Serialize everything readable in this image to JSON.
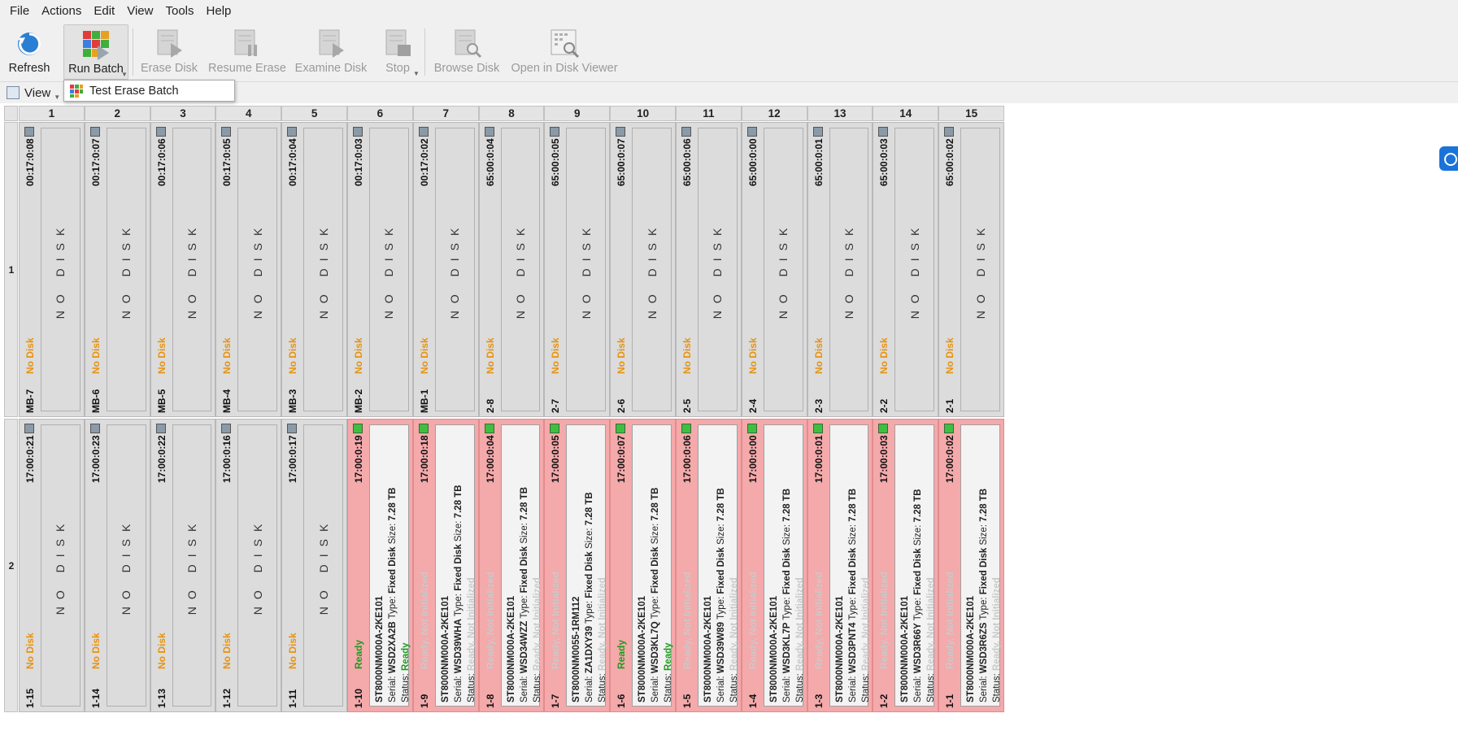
{
  "menu": [
    "File",
    "Actions",
    "Edit",
    "View",
    "Tools",
    "Help"
  ],
  "toolbar": {
    "refresh": "Refresh",
    "run_batch": "Run Batch",
    "erase_disk": "Erase Disk",
    "resume_erase": "Resume Erase",
    "examine_disk": "Examine Disk",
    "stop": "Stop",
    "browse_disk": "Browse Disk",
    "open_viewer": "Open in Disk Viewer"
  },
  "viewbar": {
    "view_label": "View"
  },
  "popup": {
    "item": "Test Erase Batch"
  },
  "grid": {
    "columns": [
      "1",
      "2",
      "3",
      "4",
      "5",
      "6",
      "7",
      "8",
      "9",
      "10",
      "11",
      "12",
      "13",
      "14",
      "15"
    ],
    "rows": [
      "1",
      "2"
    ],
    "no_disk_text": "NO DISK",
    "row1": [
      {
        "id": "MB-7",
        "time": "00:17:0:08",
        "status": "No Disk"
      },
      {
        "id": "MB-6",
        "time": "00:17:0:07",
        "status": "No Disk"
      },
      {
        "id": "MB-5",
        "time": "00:17:0:06",
        "status": "No Disk"
      },
      {
        "id": "MB-4",
        "time": "00:17:0:05",
        "status": "No Disk"
      },
      {
        "id": "MB-3",
        "time": "00:17:0:04",
        "status": "No Disk"
      },
      {
        "id": "MB-2",
        "time": "00:17:0:03",
        "status": "No Disk"
      },
      {
        "id": "MB-1",
        "time": "00:17:0:02",
        "status": "No Disk"
      },
      {
        "id": "2-8",
        "time": "65:00:0:04",
        "status": "No Disk"
      },
      {
        "id": "2-7",
        "time": "65:00:0:05",
        "status": "No Disk"
      },
      {
        "id": "2-6",
        "time": "65:00:0:07",
        "status": "No Disk"
      },
      {
        "id": "2-5",
        "time": "65:00:0:06",
        "status": "No Disk"
      },
      {
        "id": "2-4",
        "time": "65:00:0:00",
        "status": "No Disk"
      },
      {
        "id": "2-3",
        "time": "65:00:0:01",
        "status": "No Disk"
      },
      {
        "id": "2-2",
        "time": "65:00:0:03",
        "status": "No Disk"
      },
      {
        "id": "2-1",
        "time": "65:00:0:02",
        "status": "No Disk"
      }
    ],
    "row2": [
      {
        "id": "1-15",
        "time": "17:00:0:21",
        "status": "No Disk",
        "disk": false
      },
      {
        "id": "1-14",
        "time": "17:00:0:23",
        "status": "No Disk",
        "disk": false
      },
      {
        "id": "1-13",
        "time": "17:00:0:22",
        "status": "No Disk",
        "disk": false
      },
      {
        "id": "1-12",
        "time": "17:00:0:16",
        "status": "No Disk",
        "disk": false
      },
      {
        "id": "1-11",
        "time": "17:00:0:17",
        "status": "No Disk",
        "disk": false
      },
      {
        "id": "1-10",
        "time": "17:00:0:19",
        "status": "Ready",
        "disk": true,
        "model": "ST8000NM000A-2KE101",
        "serial": "WSD2XA2B",
        "type": "Fixed Disk",
        "size": "7.28 TB",
        "disk_status": "Ready"
      },
      {
        "id": "1-9",
        "time": "17:00:0:18",
        "status": "Ready, Not Initialized",
        "disk": true,
        "model": "ST8000NM000A-2KE101",
        "serial": "WSD39WHA",
        "type": "Fixed Disk",
        "size": "7.28 TB",
        "disk_status": "Ready, Not Initialized"
      },
      {
        "id": "1-8",
        "time": "17:00:0:04",
        "status": "Ready, Not Initialized",
        "disk": true,
        "model": "ST8000NM000A-2KE101",
        "serial": "WSD34WZZ",
        "type": "Fixed Disk",
        "size": "7.28 TB",
        "disk_status": "Ready, Not Initialized"
      },
      {
        "id": "1-7",
        "time": "17:00:0:05",
        "status": "Ready, Not Initialized",
        "disk": true,
        "model": "ST8000NM0055-1RM112",
        "serial": "ZA1DXY39",
        "type": "Fixed Disk",
        "size": "7.28 TB",
        "disk_status": "Ready, Not Initialized"
      },
      {
        "id": "1-6",
        "time": "17:00:0:07",
        "status": "Ready",
        "disk": true,
        "model": "ST8000NM000A-2KE101",
        "serial": "WSD3KL7Q",
        "type": "Fixed Disk",
        "size": "7.28 TB",
        "disk_status": "Ready"
      },
      {
        "id": "1-5",
        "time": "17:00:0:06",
        "status": "Ready, Not Initialized",
        "disk": true,
        "model": "ST8000NM000A-2KE101",
        "serial": "WSD39W89",
        "type": "Fixed Disk",
        "size": "7.28 TB",
        "disk_status": "Ready, Not Initialized"
      },
      {
        "id": "1-4",
        "time": "17:00:0:00",
        "status": "Ready, Not Initialized",
        "disk": true,
        "model": "ST8000NM000A-2KE101",
        "serial": "WSD3KL7P",
        "type": "Fixed Disk",
        "size": "7.28 TB",
        "disk_status": "Ready, Not Initialized"
      },
      {
        "id": "1-3",
        "time": "17:00:0:01",
        "status": "Ready, Not Initialized",
        "disk": true,
        "model": "ST8000NM000A-2KE101",
        "serial": "WSD3PNT4",
        "type": "Fixed Disk",
        "size": "7.28 TB",
        "disk_status": "Ready, Not Initialized"
      },
      {
        "id": "1-2",
        "time": "17:00:0:03",
        "status": "Ready, Not Initialized",
        "disk": true,
        "model": "ST8000NM000A-2KE101",
        "serial": "WSD3R66Y",
        "type": "Fixed Disk",
        "size": "7.28 TB",
        "disk_status": "Ready, Not Initialized"
      },
      {
        "id": "1-1",
        "time": "17:00:0:02",
        "status": "Ready, Not Initialized",
        "disk": true,
        "model": "ST8000NM000A-2KE101",
        "serial": "WSD3R6ZS",
        "type": "Fixed Disk",
        "size": "7.28 TB",
        "disk_status": "Ready, Not Initialized"
      }
    ],
    "labels": {
      "serial": "Serial:",
      "type": "Type:",
      "size": "Size:",
      "status": "Status:"
    }
  },
  "colors": {
    "no_disk": "#e8920c",
    "ready": "#1e9b1e",
    "not_init": "#c9c9c9",
    "disk_bg": "#f4a9ab"
  }
}
